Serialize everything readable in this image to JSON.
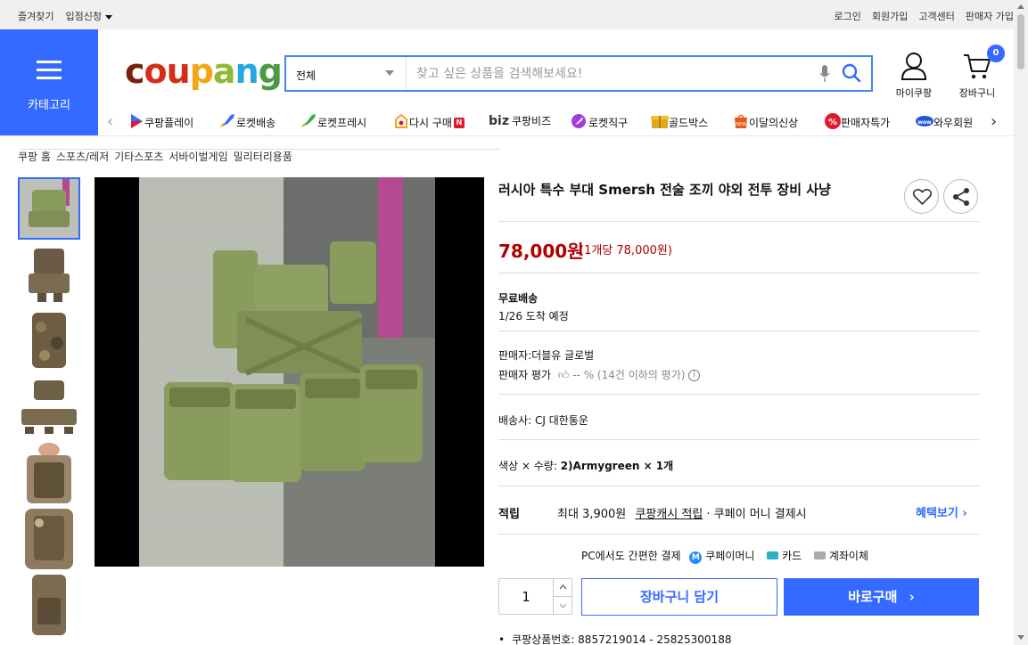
{
  "topbar": {
    "favorites": "즐겨찾기",
    "apply": "입점신청",
    "login": "로그인",
    "signup": "회원가입",
    "support": "고객센터",
    "seller_signup": "판매자 가입"
  },
  "header": {
    "category_label": "카테고리",
    "logo": {
      "c": "c",
      "o": "ou",
      "p": "p",
      "a": "a",
      "n": "n",
      "g": "g"
    },
    "search": {
      "category": "전체",
      "placeholder": "찾고 싶은 상품을 검색해보세요!"
    },
    "mycoupang": "마이쿠팡",
    "cart": "장바구니",
    "cart_count": "0"
  },
  "shortcuts": [
    {
      "label": "쿠팡플레이",
      "icon": "play-icon",
      "color": "#346aff"
    },
    {
      "label": "로켓배송",
      "icon": "rocket-icon",
      "color": "#346aff"
    },
    {
      "label": "로켓프레시",
      "icon": "rocket-fresh-icon",
      "color": "#3aa843"
    },
    {
      "label": "다시 구매",
      "icon": "repurchase-icon",
      "color": "#f4a417",
      "badge": "N"
    },
    {
      "label": "쿠팡비즈",
      "icon": "biz-icon",
      "prefix": "biz",
      "color": "#111111"
    },
    {
      "label": "로켓직구",
      "icon": "rocket-global-icon",
      "color": "#a23cd6"
    },
    {
      "label": "골드박스",
      "icon": "goldbox-icon",
      "color": "#e0a91b"
    },
    {
      "label": "이달의신상",
      "icon": "new-icon",
      "color": "#e85a1b"
    },
    {
      "label": "판매자특가",
      "icon": "percent-icon",
      "color": "#e3182d"
    },
    {
      "label": "와우회원",
      "icon": "wow-icon",
      "color": "#1e58d8"
    }
  ],
  "breadcrumb": [
    "쿠팡 홈",
    "스포츠/레저",
    "기타스포츠",
    "서바이벌게임",
    "밀리터리용품"
  ],
  "product": {
    "title": "러시아 특수 부대 Smersh 전술 조끼 야외 전투 장비 사냥",
    "price": "78,000원",
    "unit_price": "(1개당 78,000원)",
    "shipping_title": "무료배송",
    "arrival": "1/26 도착 예정",
    "seller": "판매자:더블유 글로벌",
    "seller_rating_label": "판매자 평가",
    "seller_rating_value": "-- % (14건 이하의 평가)",
    "courier": "배송사:  CJ 대한통운",
    "option_label": "색상 × 수량: ",
    "option_value": "2)Armygreen × 1개",
    "reward_label": "적립",
    "reward_max": "최대 3,900원",
    "reward_link": "쿠팡캐시 적립",
    "reward_rest": "· 쿠페이 머니 결제시",
    "benefit": "혜택보기 ›",
    "pay_label": "PC에서도 간편한 결제",
    "pay_methods": [
      "쿠페이머니",
      "카드",
      "계좌이체"
    ],
    "quantity": "1",
    "add_to_cart": "장바구니 담기",
    "buy_now": "바로구매",
    "product_id": "쿠팡상품번호: 8857219014 - 25825300188"
  },
  "colors": {
    "accent": "#346aff",
    "price": "#ae0000",
    "vest": "#8a9b5e"
  }
}
